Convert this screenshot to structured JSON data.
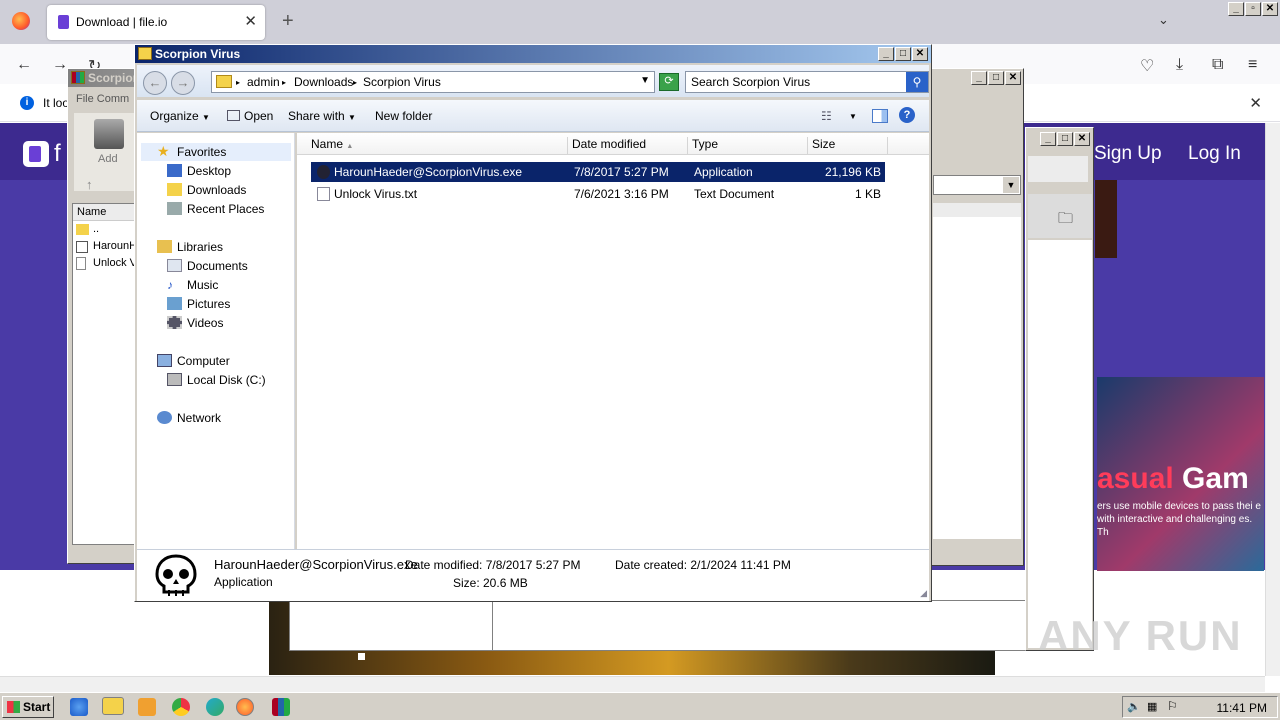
{
  "browser": {
    "tab_title": "Download | file.io",
    "notice_text": "It loo",
    "page_logo_text": "f",
    "sign_up": "Sign Up",
    "log_in": "Log In",
    "promo_heading_a": "asual",
    "promo_heading_b": " Gam",
    "promo_text": "ers use mobile devices to pass thei e with interactive and challenging es. Th",
    "watermark": "ANY RUN"
  },
  "winrar": {
    "title": "Scorpion",
    "menu": "File   Comm",
    "add_label": "Add",
    "name_col": "Name",
    "files": [
      "..",
      "HarounH",
      "Unlock V"
    ]
  },
  "explorer": {
    "title": "Scorpion Virus",
    "breadcrumb": [
      "admin",
      "Downloads",
      "Scorpion Virus"
    ],
    "search_placeholder": "Search Scorpion Virus",
    "toolbar": {
      "organize": "Organize",
      "open": "Open",
      "share_with": "Share with",
      "new_folder": "New folder"
    },
    "nav": {
      "favorites": "Favorites",
      "desktop": "Desktop",
      "downloads": "Downloads",
      "recent_places": "Recent Places",
      "libraries": "Libraries",
      "documents": "Documents",
      "music": "Music",
      "pictures": "Pictures",
      "videos": "Videos",
      "computer": "Computer",
      "local_disk": "Local Disk (C:)",
      "network": "Network"
    },
    "columns": {
      "name": "Name",
      "date_modified": "Date modified",
      "type": "Type",
      "size": "Size"
    },
    "files": [
      {
        "name": "HarounHaeder@ScorpionVirus.exe",
        "date": "7/8/2017 5:27 PM",
        "type": "Application",
        "size": "21,196 KB"
      },
      {
        "name": "Unlock Virus.txt",
        "date": "7/6/2021 3:16 PM",
        "type": "Text Document",
        "size": "1 KB"
      }
    ],
    "details": {
      "filename": "HarounHaeder@ScorpionVirus.exe",
      "type": "Application",
      "date_modified": "Date modified: 7/8/2017 5:27 PM",
      "size": "Size: 20.6 MB",
      "date_created": "Date created: 2/1/2024 11:41 PM"
    }
  },
  "taskbar": {
    "start": "Start",
    "clock": "11:41 PM"
  },
  "colors": {
    "accent": "#0a246a",
    "brand": "#4a3aa6"
  }
}
